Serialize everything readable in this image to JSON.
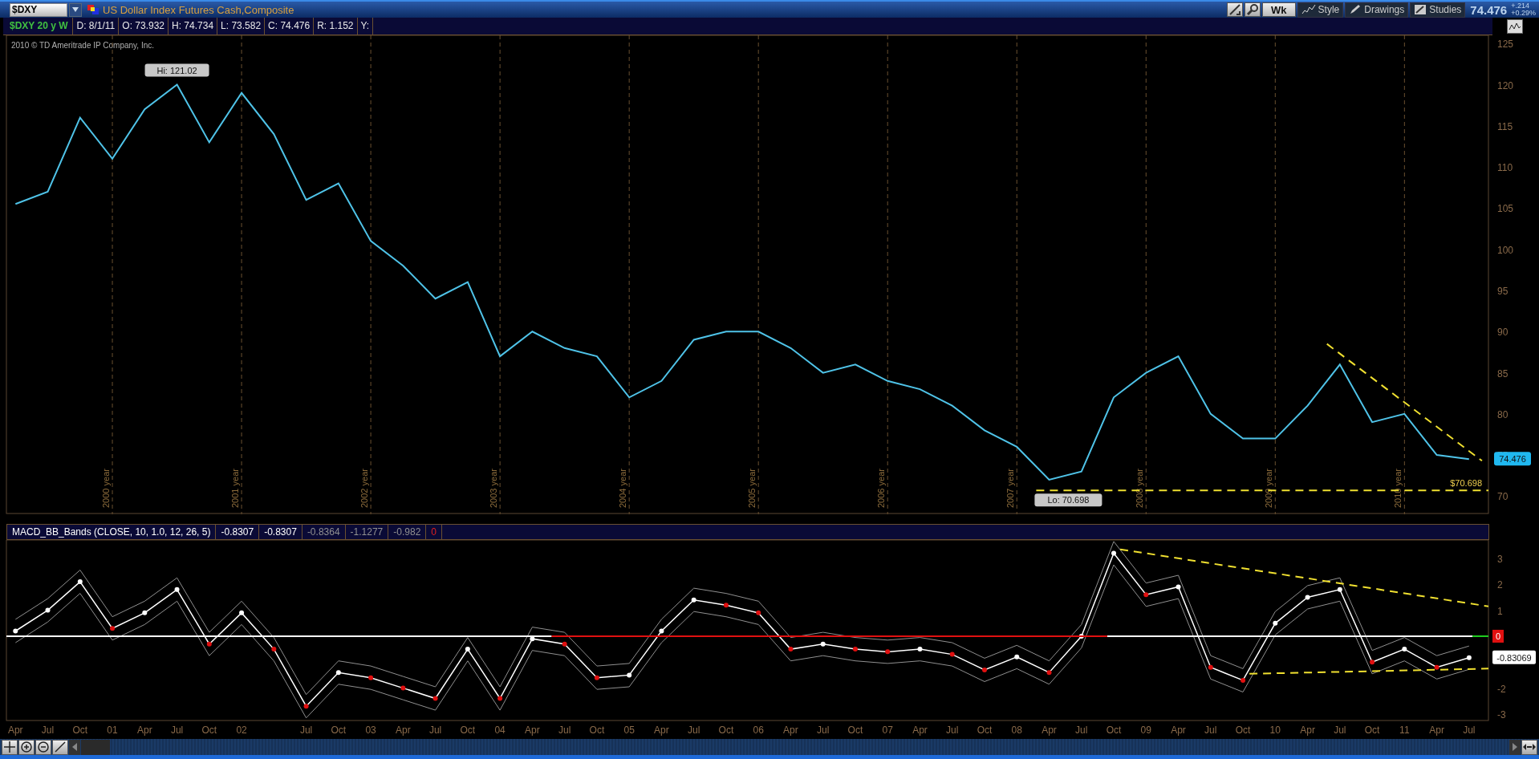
{
  "toolbar": {
    "symbol": "$DXY",
    "description": "US Dollar Index Futures Cash,Composite",
    "period_button": "Wk",
    "style_button": "Style",
    "drawings_button": "Drawings",
    "studies_button": "Studies",
    "last_price": "74.476",
    "net_change": "+.214",
    "percent_change": "+0.29%"
  },
  "info_bar": {
    "chart_label": "$DXY 20 y W",
    "fields": [
      "D: 8/1/11",
      "O: 73.932",
      "H: 74.734",
      "L: 73.582",
      "C: 74.476",
      "R: 1.152",
      "Y:"
    ]
  },
  "price_chart": {
    "copyright": "2010 © TD Ameritrade IP Company, Inc.",
    "year_markers": [
      "2000 year",
      "2001 year",
      "2002 year",
      "2003 year",
      "2004 year",
      "2005 year",
      "2006 year",
      "2007 year",
      "2008 year",
      "2009 year",
      "2010 year"
    ],
    "high_label": "Hi: 121.02",
    "low_label": "Lo: 70.698",
    "support_label": "$70.698",
    "last_price_tag": "74.476",
    "chart_data": {
      "type": "line",
      "grid": true,
      "categories": [
        null,
        null,
        null,
        null,
        null,
        null,
        null,
        null,
        null,
        null,
        null,
        null,
        null,
        null,
        null,
        null,
        null,
        null,
        null,
        null,
        null,
        null,
        null,
        null,
        null,
        null,
        null,
        null,
        null,
        null,
        null,
        null,
        null,
        null,
        null,
        null,
        null,
        null,
        null,
        null,
        null,
        null,
        null,
        null,
        null,
        null
      ],
      "ylim": [
        67.8,
        126
      ],
      "yticks": [
        70,
        75,
        80,
        85,
        90,
        95,
        100,
        105,
        110,
        115,
        120,
        125
      ],
      "series": [
        {
          "color": "#4fc3e8",
          "values": [
            105.5,
            107,
            116,
            111,
            117,
            120,
            113,
            119,
            114,
            106,
            108,
            101,
            98,
            94,
            96,
            87,
            90,
            88,
            87,
            82,
            84,
            89,
            90,
            90,
            88,
            85,
            86,
            84,
            83,
            81,
            78,
            76,
            72,
            73,
            82,
            85,
            87,
            80,
            77,
            77,
            81,
            86,
            79,
            80,
            75,
            74.5
          ]
        }
      ]
    }
  },
  "study": {
    "title": "MACD_BB_Bands (CLOSE, 10, 1.0, 12, 26, 5)",
    "values": [
      {
        "text": "-0.8307",
        "kind": "bright"
      },
      {
        "text": "-0.8307",
        "kind": "bright"
      },
      {
        "text": "-0.8364",
        "kind": "dim"
      },
      {
        "text": "-1.1277",
        "kind": "dim"
      },
      {
        "text": "-0.982",
        "kind": "dim"
      },
      {
        "text": "0",
        "kind": "alert"
      }
    ],
    "zero_tag": "0",
    "last_value_tag": "-0.83069",
    "chart_data": {
      "type": "line",
      "ylim": [
        -3.28,
        3.71
      ],
      "yticks": [
        -3,
        -2,
        1,
        2,
        3
      ],
      "categories": [
        "Apr",
        "Jul",
        "Oct",
        "01",
        "Apr",
        "Jul",
        "Oct",
        "02",
        null,
        "Jul",
        "Oct",
        "03",
        "Apr",
        "Jul",
        "Oct",
        "04",
        "Apr",
        "Jul",
        "Oct",
        "05",
        "Apr",
        "Jul",
        "Oct",
        "06",
        "Apr",
        "Jul",
        "Oct",
        "07",
        "Apr",
        "Jul",
        "Oct",
        "08",
        "Apr",
        "Jul",
        "Oct",
        "09",
        "Apr",
        "Jul",
        "Oct",
        "10",
        "Apr",
        "Jul",
        "Oct",
        "11",
        "Apr",
        "Jul"
      ],
      "series": [
        {
          "color": "#ffffff",
          "marker": "circle",
          "values": [
            0.2,
            1.0,
            2.1,
            0.3,
            0.9,
            1.8,
            -0.3,
            0.9,
            -0.5,
            -2.7,
            -1.4,
            -1.6,
            -2.0,
            -2.4,
            -0.5,
            -2.4,
            -0.1,
            -0.3,
            -1.6,
            -1.5,
            0.2,
            1.4,
            1.2,
            0.9,
            -0.5,
            -0.3,
            -0.5,
            -0.6,
            -0.5,
            -0.7,
            -1.3,
            -0.8,
            -1.4,
            0.0,
            3.2,
            1.6,
            1.9,
            -1.2,
            -1.7,
            0.5,
            1.5,
            1.8,
            -1.0,
            -0.5,
            -1.2,
            -0.83
          ]
        },
        {
          "color": "#909090",
          "values": [
            0.65,
            1.45,
            2.55,
            0.75,
            1.35,
            2.25,
            0.15,
            1.35,
            -0.05,
            -2.25,
            -0.95,
            -1.15,
            -1.55,
            -1.95,
            -0.05,
            -1.95,
            0.35,
            0.15,
            -1.15,
            -1.05,
            0.65,
            1.85,
            1.65,
            1.35,
            -0.05,
            0.15,
            -0.05,
            -0.15,
            -0.05,
            -0.25,
            -0.85,
            -0.35,
            -0.95,
            0.45,
            3.65,
            2.05,
            2.35,
            -0.75,
            -1.25,
            0.95,
            1.95,
            2.25,
            -0.55,
            -0.05,
            -0.75,
            -0.38
          ]
        },
        {
          "color": "#909090",
          "values": [
            -0.25,
            0.55,
            1.65,
            -0.15,
            0.45,
            1.35,
            -0.75,
            0.45,
            -0.95,
            -3.15,
            -1.85,
            -2.05,
            -2.45,
            -2.85,
            -0.95,
            -2.85,
            -0.55,
            -0.75,
            -2.05,
            -1.95,
            -0.25,
            0.95,
            0.75,
            0.45,
            -0.95,
            -0.75,
            -0.95,
            -1.05,
            -0.95,
            -1.15,
            -1.75,
            -1.25,
            -1.85,
            -0.45,
            2.75,
            1.15,
            1.45,
            -1.65,
            -2.15,
            0.05,
            1.05,
            1.35,
            -1.45,
            -0.95,
            -1.65,
            -1.28
          ]
        }
      ]
    }
  }
}
